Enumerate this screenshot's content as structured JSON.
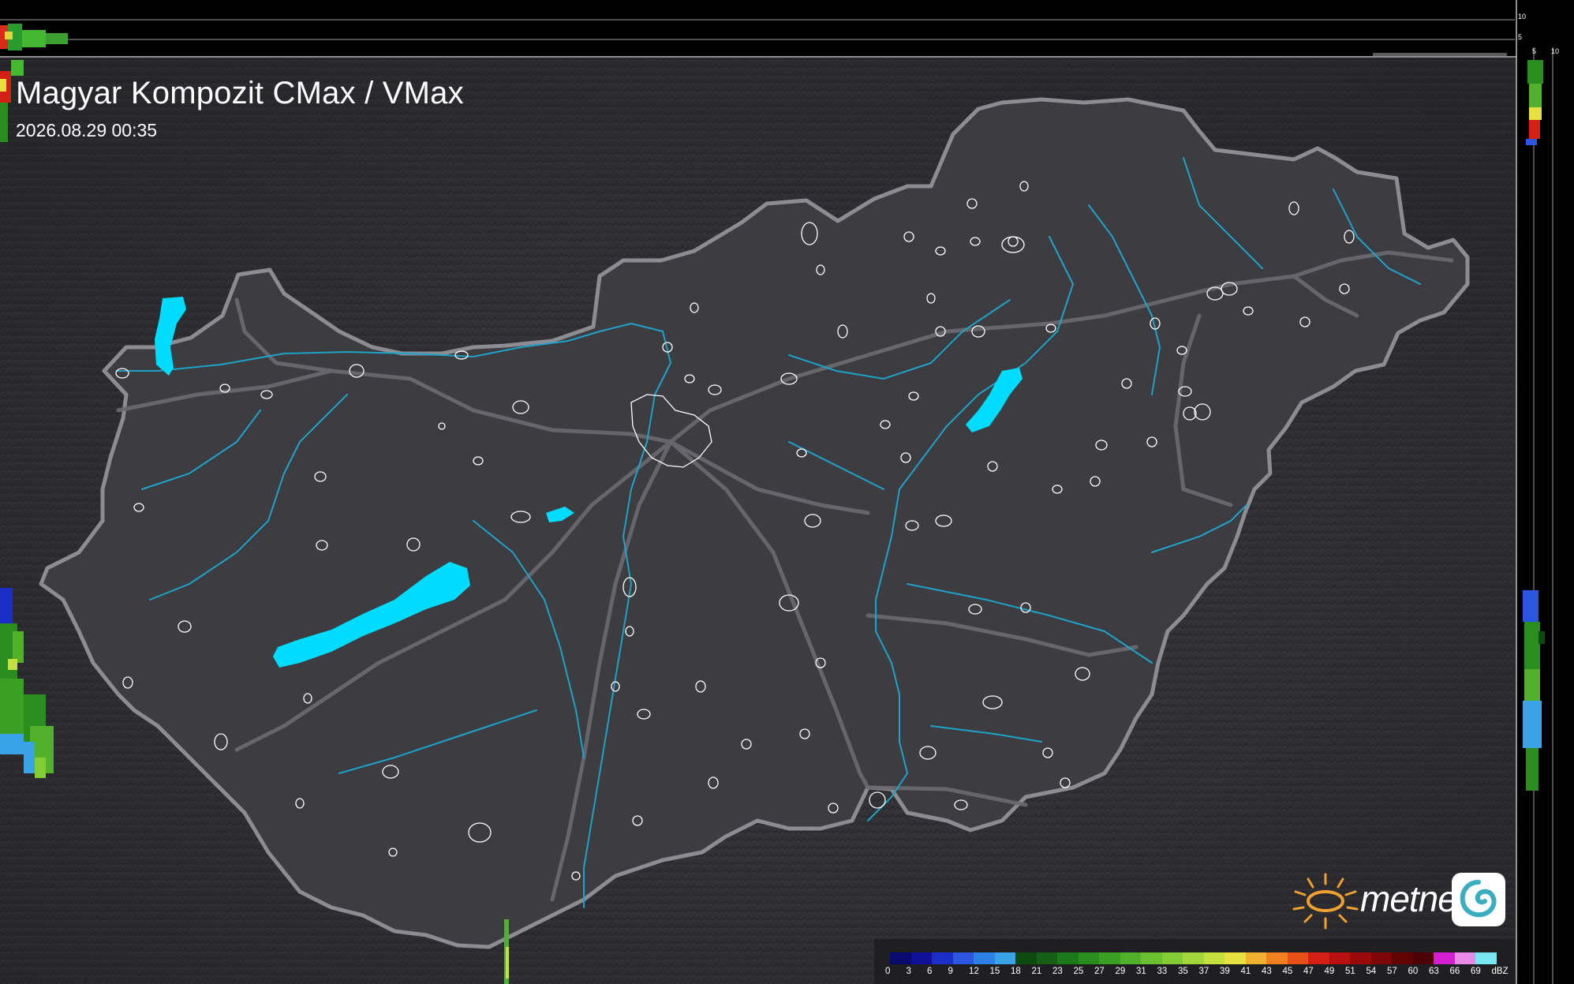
{
  "map": {
    "title": "Magyar Kompozit CMax / VMax",
    "timestamp": "2026.08.29 00:35",
    "region": "Hungary",
    "background_color": "#2b2b2f",
    "country_fill": "#3b3b40",
    "border_color": "#8c8c92",
    "river_color": "#1ea3c8",
    "lake_color": "#00dcff",
    "road_color": "#6a6a70"
  },
  "legend": {
    "unit": "dBZ",
    "ticks": [
      "0",
      "3",
      "6",
      "9",
      "12",
      "15",
      "18",
      "21",
      "23",
      "25",
      "27",
      "29",
      "31",
      "33",
      "35",
      "37",
      "39",
      "41",
      "43",
      "45",
      "47",
      "49",
      "51",
      "54",
      "57",
      "60",
      "63",
      "66",
      "69"
    ],
    "colors": [
      "#0a0a6e",
      "#10109a",
      "#1b2ec8",
      "#2a56e0",
      "#2e7fe6",
      "#3aa3e8",
      "#0f4a10",
      "#156014",
      "#1c7a1a",
      "#2a8e1e",
      "#3aa024",
      "#52b02a",
      "#6ac030",
      "#84cc34",
      "#a2d63a",
      "#c4e03e",
      "#e6e040",
      "#f0b030",
      "#f08020",
      "#e85018",
      "#d42014",
      "#b81010",
      "#9a0a0a",
      "#7e0606",
      "#620404",
      "#4a0202",
      "#d020d0",
      "#e88ae8",
      "#7ae8f0"
    ]
  },
  "side_panel": {
    "top_ticks": [
      "10",
      "5"
    ],
    "bottom_ticks": [
      "5",
      "10"
    ]
  },
  "brand": {
    "name": "metnet",
    "sun_icon": "sun-icon",
    "badge_icon": "swirl-icon"
  }
}
